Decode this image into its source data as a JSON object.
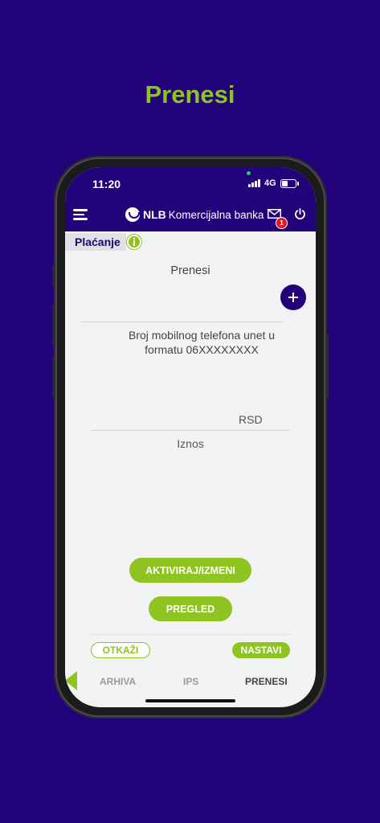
{
  "headline": "Prenesi",
  "status_bar": {
    "time": "11:20",
    "network": "4G",
    "battery_level": 0.45
  },
  "app_bar": {
    "logo_nlb": "NLB",
    "logo_rest": "Komercijalna banka",
    "mail_badge_count": "1"
  },
  "section": {
    "tab_label": "Plaćanje"
  },
  "form": {
    "title": "Prenesi",
    "phone_hint": "Broj mobilnog telefona unet u formatu 06XXXXXXXX",
    "currency": "RSD",
    "amount_label": "Iznos"
  },
  "buttons": {
    "activate": "AKTIVIRAJ/IZMENI",
    "review": "PREGLED",
    "cancel": "OTKAŽI",
    "next": "NASTAVI"
  },
  "bottom_tabs": [
    {
      "label": "ARHIVA",
      "active": false
    },
    {
      "label": "IPS",
      "active": false
    },
    {
      "label": "PRENESI",
      "active": true
    }
  ],
  "colors": {
    "brand": "#23037a",
    "accent": "#8fc31f",
    "badge": "#e1191e"
  }
}
